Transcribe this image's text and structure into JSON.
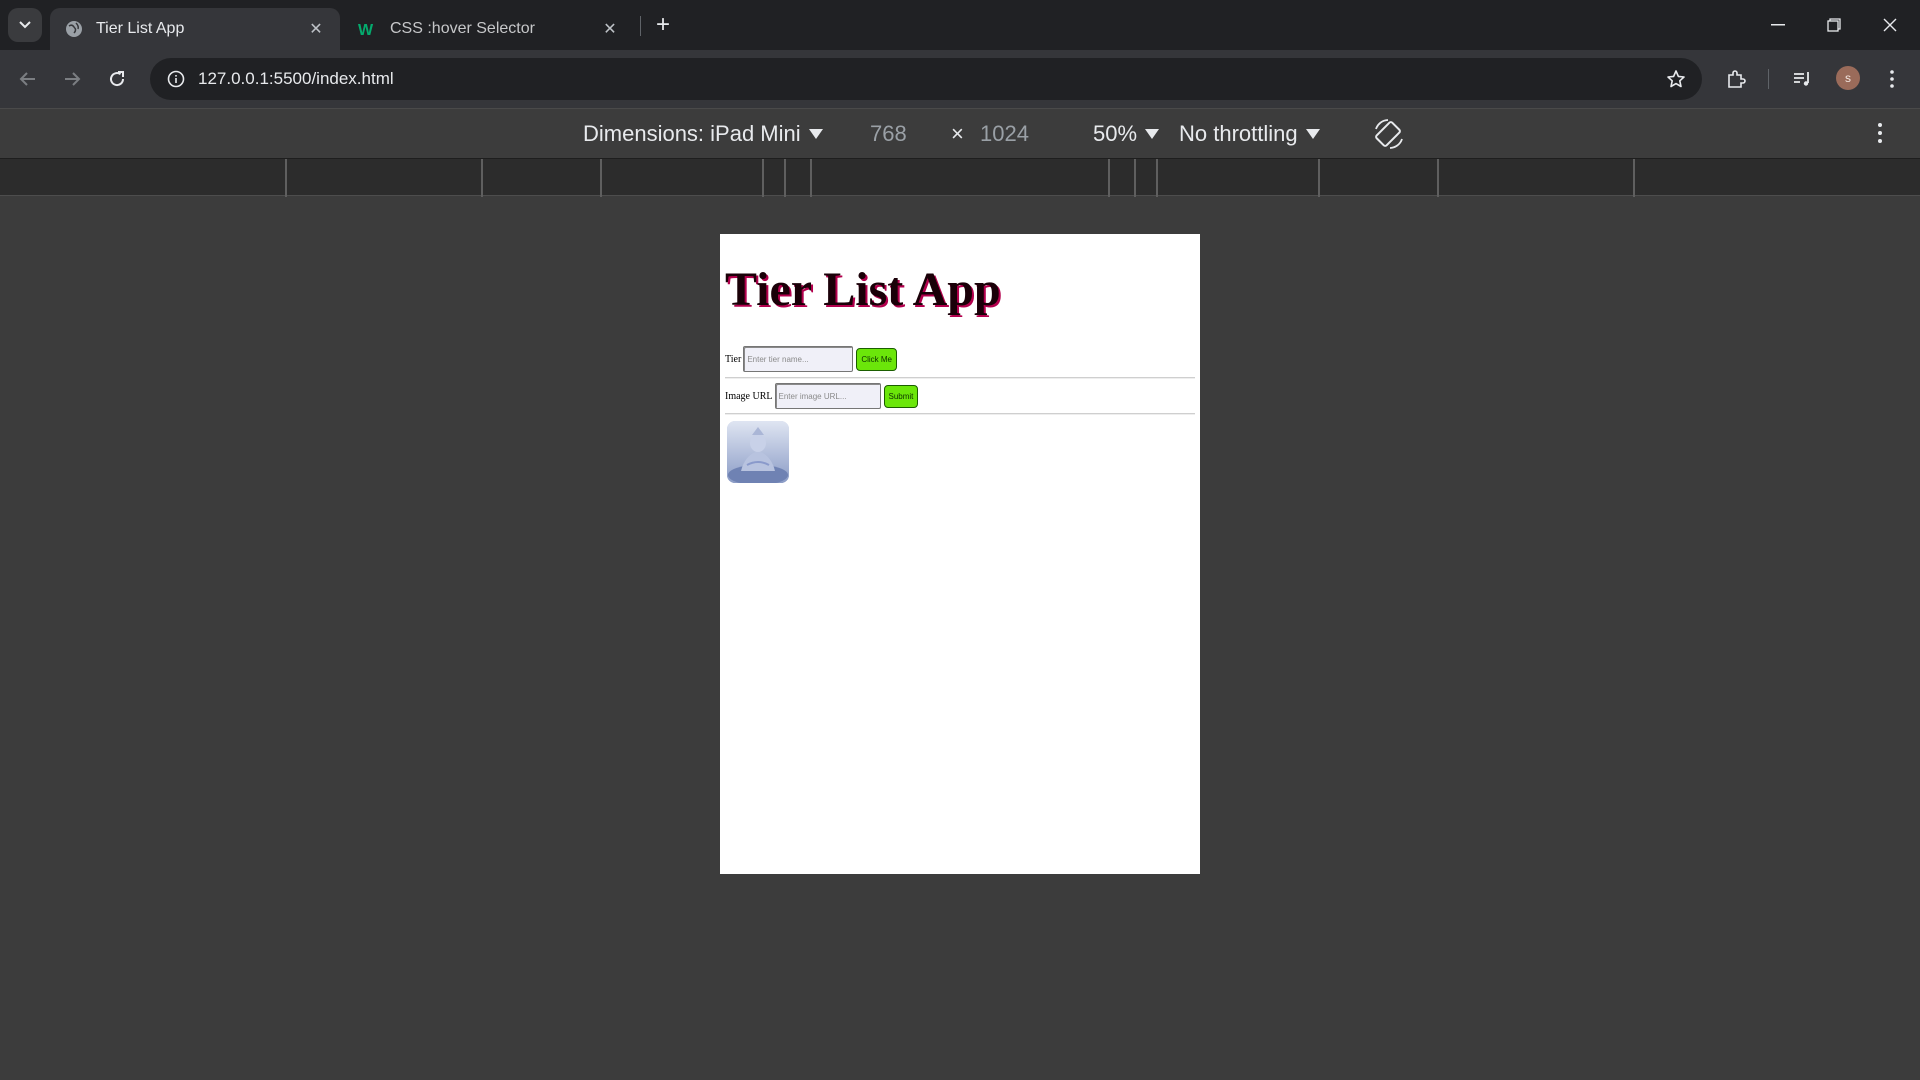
{
  "browser": {
    "tabs": [
      {
        "title": "Tier List App",
        "active": true,
        "favicon": "globe-icon"
      },
      {
        "title": "CSS :hover Selector",
        "active": false,
        "favicon": "w3schools-icon"
      }
    ],
    "url": "127.0.0.1:5500/index.html",
    "profile_initial": "s"
  },
  "devtools": {
    "dimensions_label": "Dimensions: iPad Mini",
    "width": "768",
    "times": "×",
    "height": "1024",
    "zoom": "50%",
    "throttling": "No throttling"
  },
  "page": {
    "title": "Tier List App",
    "tier_label": "Tier",
    "tier_placeholder": "Enter tier name...",
    "tier_button": "Click Me",
    "image_label": "Image URL",
    "image_placeholder": "Enter image URL...",
    "image_button": "Submit",
    "image_alt": "tier image"
  },
  "colors": {
    "chrome_dark": "#202124",
    "chrome_toolbar": "#35363a",
    "devtools_bg": "#3c3c3c",
    "button_green": "#6be60a",
    "title_shadow": "#b3004d"
  }
}
